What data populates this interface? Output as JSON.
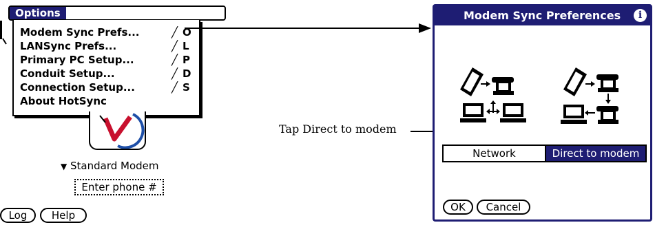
{
  "left_screen": {
    "menu_title": "Options",
    "menu_items": [
      {
        "label": "Modem Sync Prefs...",
        "shortcut": "O"
      },
      {
        "label": "LANSync Prefs...",
        "shortcut": "L"
      },
      {
        "label": "Primary PC Setup...",
        "shortcut": "P"
      },
      {
        "label": "Conduit Setup...",
        "shortcut": "D"
      },
      {
        "label": "Connection Setup...",
        "shortcut": "S"
      },
      {
        "label": "About HotSync",
        "shortcut": ""
      }
    ],
    "shortcut_stroke": "╱",
    "modem_select": "Standard Modem",
    "phone_field": "Enter phone #",
    "buttons": {
      "log": "Log",
      "help": "Help"
    }
  },
  "right_screen": {
    "title": "Modem Sync Preferences",
    "info_icon": "info-icon",
    "segments": {
      "network": "Network",
      "direct": "Direct to modem"
    },
    "selected_segment": "direct",
    "buttons": {
      "ok": "OK",
      "cancel": "Cancel"
    }
  },
  "callout": {
    "text": "Tap Direct to modem"
  },
  "colors": {
    "accent": "#1e1d73",
    "logo_red": "#c8102e",
    "logo_blue": "#1e4fa8"
  }
}
